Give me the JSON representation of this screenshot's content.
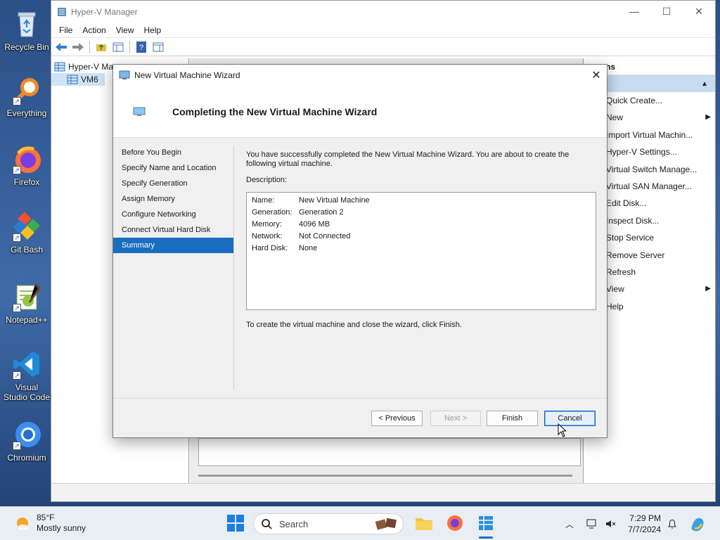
{
  "desktop": {
    "icons": [
      {
        "label": "Recycle Bin"
      },
      {
        "label": "Everything"
      },
      {
        "label": "Firefox"
      },
      {
        "label": "Git Bash"
      },
      {
        "label": "Notepad++"
      },
      {
        "label": "Visual Studio Code"
      },
      {
        "label": "Chromium"
      }
    ]
  },
  "hyperv": {
    "title": "Hyper-V Manager",
    "menu": [
      "File",
      "Action",
      "View",
      "Help"
    ],
    "tree": {
      "root": "Hyper-V Ma",
      "child": "VM6"
    },
    "actions_header": "ns",
    "actions": [
      {
        "label": "Quick Create...",
        "submenu": false
      },
      {
        "label": "New",
        "submenu": true
      },
      {
        "label": "Import Virtual Machin...",
        "submenu": false
      },
      {
        "label": "Hyper-V Settings...",
        "submenu": false
      },
      {
        "label": "Virtual Switch Manage...",
        "submenu": false
      },
      {
        "label": "Virtual SAN Manager...",
        "submenu": false
      },
      {
        "label": "Edit Disk...",
        "submenu": false
      },
      {
        "label": "Inspect Disk...",
        "submenu": false
      },
      {
        "label": "Stop Service",
        "submenu": false
      },
      {
        "label": "Remove Server",
        "submenu": false
      },
      {
        "label": "Refresh",
        "submenu": false
      },
      {
        "label": "View",
        "submenu": true
      },
      {
        "label": "Help",
        "submenu": false
      }
    ]
  },
  "wizard": {
    "title": "New Virtual Machine Wizard",
    "heading": "Completing the New Virtual Machine Wizard",
    "steps": [
      "Before You Begin",
      "Specify Name and Location",
      "Specify Generation",
      "Assign Memory",
      "Configure Networking",
      "Connect Virtual Hard Disk",
      "Summary"
    ],
    "active_step": "Summary",
    "intro": "You have successfully completed the New Virtual Machine Wizard. You are about to create the following virtual machine.",
    "description_label": "Description:",
    "summary": [
      {
        "key": "Name:",
        "value": "New Virtual Machine"
      },
      {
        "key": "Generation:",
        "value": "Generation 2"
      },
      {
        "key": "Memory:",
        "value": "4096 MB"
      },
      {
        "key": "Network:",
        "value": "Not Connected"
      },
      {
        "key": "Hard Disk:",
        "value": "None"
      }
    ],
    "finish_hint": "To create the virtual machine and close the wizard, click Finish.",
    "buttons": {
      "previous": "< Previous",
      "next": "Next >",
      "finish": "Finish",
      "cancel": "Cancel"
    }
  },
  "taskbar": {
    "weather_temp": "85°F",
    "weather_desc": "Mostly sunny",
    "search_placeholder": "Search",
    "time": "7:29 PM",
    "date": "7/7/2024"
  },
  "colors": {
    "accent": "#1a6ec0",
    "selection": "#c7dcf0"
  }
}
